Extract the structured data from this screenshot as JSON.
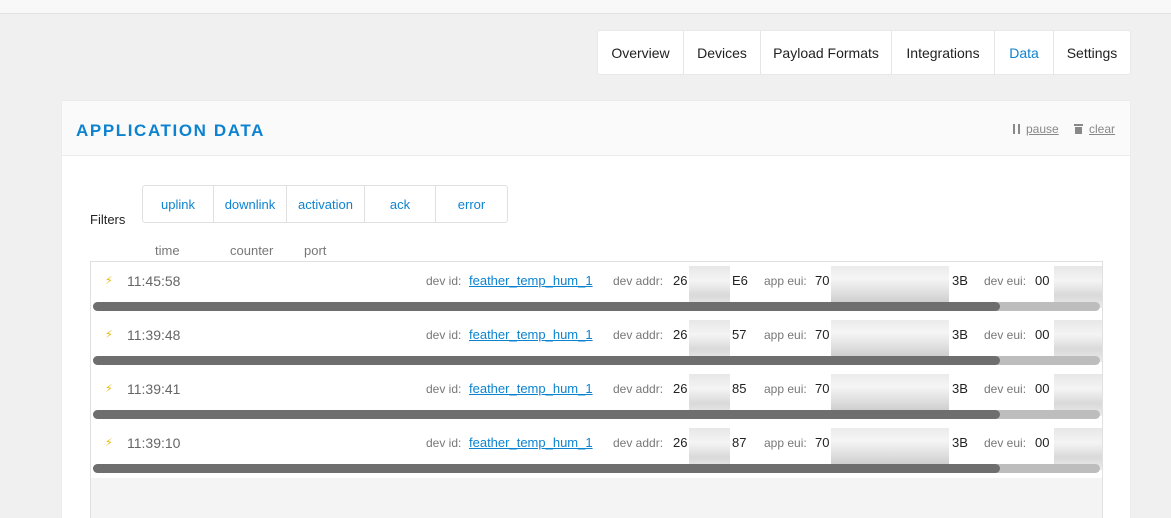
{
  "tabs": [
    {
      "label": "Overview",
      "active": false
    },
    {
      "label": "Devices",
      "active": false
    },
    {
      "label": "Payload Formats",
      "active": false
    },
    {
      "label": "Integrations",
      "active": false
    },
    {
      "label": "Data",
      "active": true
    },
    {
      "label": "Settings",
      "active": false
    }
  ],
  "panel": {
    "title": "APPLICATION DATA",
    "pause_label": "pause",
    "clear_label": "clear"
  },
  "filters": {
    "label": "Filters",
    "items": [
      "uplink",
      "downlink",
      "activation",
      "ack",
      "error"
    ]
  },
  "columns": {
    "time": "time",
    "counter": "counter",
    "port": "port"
  },
  "labels": {
    "dev_id": "dev id:",
    "dev_addr": "dev addr:",
    "app_eui": "app eui:",
    "dev_eui": "dev eui:"
  },
  "rows": [
    {
      "time": "11:45:58",
      "dev_id": "feather_temp_hum_1",
      "dev_addr_start": "26",
      "dev_addr_end": "E6",
      "app_eui_start": "70",
      "app_eui_end": "3B",
      "dev_eui_start": "00"
    },
    {
      "time": "11:39:48",
      "dev_id": "feather_temp_hum_1",
      "dev_addr_start": "26",
      "dev_addr_end": "57",
      "app_eui_start": "70",
      "app_eui_end": "3B",
      "dev_eui_start": "00"
    },
    {
      "time": "11:39:41",
      "dev_id": "feather_temp_hum_1",
      "dev_addr_start": "26",
      "dev_addr_end": "85",
      "app_eui_start": "70",
      "app_eui_end": "3B",
      "dev_eui_start": "00"
    },
    {
      "time": "11:39:10",
      "dev_id": "feather_temp_hum_1",
      "dev_addr_start": "26",
      "dev_addr_end": "87",
      "app_eui_start": "70",
      "app_eui_end": "3B",
      "dev_eui_start": "00"
    }
  ],
  "icons": {
    "event": "bolt-icon",
    "pause": "pause-icon",
    "clear": "trash-icon"
  },
  "colors": {
    "accent": "#0d83d0",
    "event_bolt": "#e8b800"
  }
}
